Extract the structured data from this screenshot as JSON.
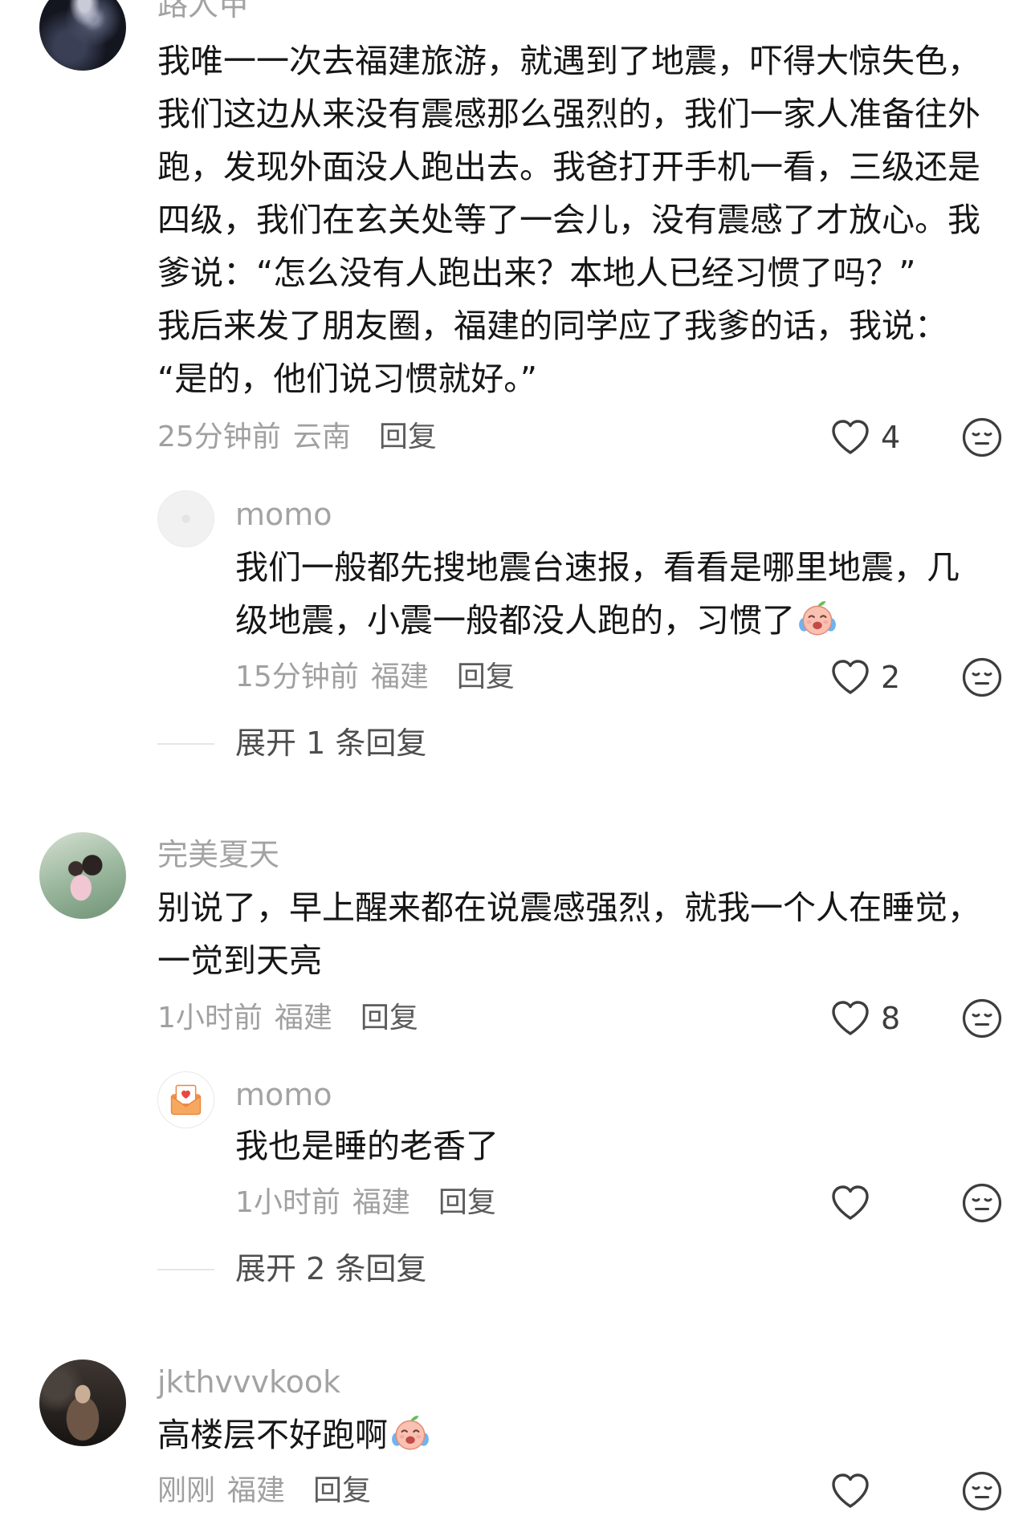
{
  "colors": {
    "text": "#161616",
    "username": "#a3a3a3",
    "meta": "#a0a0a0",
    "reply": "#5c5c5c",
    "icon": "#3d3d3d",
    "divider": "#e6e6e6",
    "expand": "#4e4e4e"
  },
  "icons": {
    "like": "heart-icon",
    "dislike": "meh-face-icon",
    "emoji": "crying-emoji"
  },
  "comments": [
    {
      "username": "路人甲",
      "lines": [
        "我唯一一次去福建旅游，就遇到了地震，吓得大惊失色，",
        "我们这边从来没有震感那么强烈的，我们一家人准备往外",
        "跑，发现外面没人跑出去。我爸打开手机一看，三级还是",
        "四级，我们在玄关处等了一会儿，没有震感了才放心。我",
        "爹说：“怎么没有人跑出来？本地人已经习惯了吗？”",
        "我后来发了朋友圈，福建的同学应了我爹的话，我说：",
        "“是的，他们说习惯就好。”"
      ],
      "time": "25分钟前",
      "location": "云南",
      "reply_label": "回复",
      "likes": "4",
      "replies": [
        {
          "username": "momo",
          "lines": [
            "我们一般都先搜地震台速报，看看是哪里地震，几",
            "级地震，小震一般都没人跑的，习惯了"
          ],
          "emoji": "crying-emoji",
          "time": "15分钟前",
          "location": "福建",
          "reply_label": "回复",
          "likes": "2"
        }
      ],
      "expand_label": "展开 1 条回复"
    },
    {
      "username": "完美夏天",
      "lines": [
        "别说了，早上醒来都在说震感强烈，就我一个人在睡觉，",
        "一觉到天亮"
      ],
      "time": "1小时前",
      "location": "福建",
      "reply_label": "回复",
      "likes": "8",
      "replies": [
        {
          "username": "momo",
          "lines": [
            "我也是睡的老香了"
          ],
          "time": "1小时前",
          "location": "福建",
          "reply_label": "回复"
        }
      ],
      "expand_label": "展开 2 条回复"
    },
    {
      "username": "jkthvvvkook",
      "lines": [
        "高楼层不好跑啊"
      ],
      "emoji": "crying-emoji",
      "time": "刚刚",
      "location": "福建",
      "reply_label": "回复"
    }
  ]
}
